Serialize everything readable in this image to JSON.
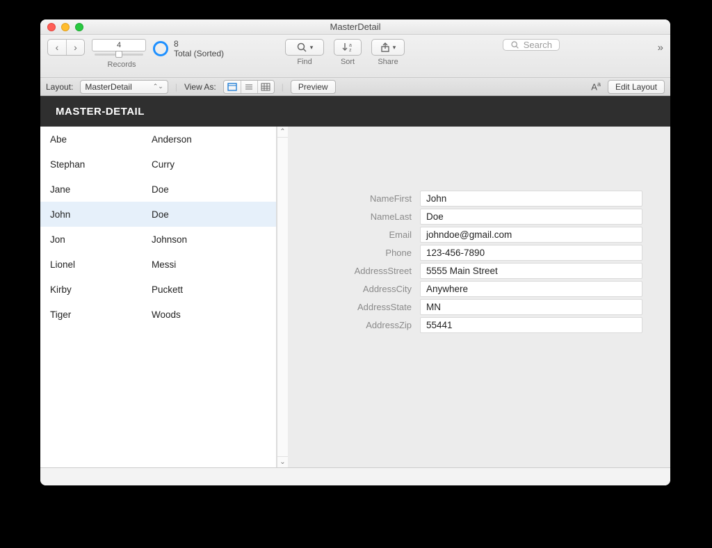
{
  "window": {
    "title": "MasterDetail"
  },
  "toolbar": {
    "record_current": "4",
    "records_caption": "Records",
    "total_count": "8",
    "total_label": "Total (Sorted)",
    "find_caption": "Find",
    "sort_caption": "Sort",
    "share_caption": "Share",
    "search_placeholder": "Search",
    "overflow": "»"
  },
  "layoutbar": {
    "layout_label": "Layout:",
    "layout_value": "MasterDetail",
    "viewas_label": "View As:",
    "preview_label": "Preview",
    "edit_layout_label": "Edit Layout"
  },
  "header": {
    "title": "MASTER-DETAIL"
  },
  "master_rows": [
    {
      "first": "Abe",
      "last": "Anderson",
      "selected": false
    },
    {
      "first": "Stephan",
      "last": "Curry",
      "selected": false
    },
    {
      "first": "Jane",
      "last": "Doe",
      "selected": false
    },
    {
      "first": "John",
      "last": "Doe",
      "selected": true
    },
    {
      "first": "Jon",
      "last": "Johnson",
      "selected": false
    },
    {
      "first": "Lionel",
      "last": "Messi",
      "selected": false
    },
    {
      "first": "Kirby",
      "last": "Puckett",
      "selected": false
    },
    {
      "first": "Tiger",
      "last": "Woods",
      "selected": false
    }
  ],
  "detail": {
    "fields": [
      {
        "label": "NameFirst",
        "value": "John"
      },
      {
        "label": "NameLast",
        "value": "Doe"
      },
      {
        "label": "Email",
        "value": "johndoe@gmail.com"
      },
      {
        "label": "Phone",
        "value": "123-456-7890"
      },
      {
        "label": "AddressStreet",
        "value": "5555 Main Street"
      },
      {
        "label": "AddressCity",
        "value": "Anywhere"
      },
      {
        "label": "AddressState",
        "value": "MN"
      },
      {
        "label": "AddressZip",
        "value": "55441"
      }
    ]
  }
}
